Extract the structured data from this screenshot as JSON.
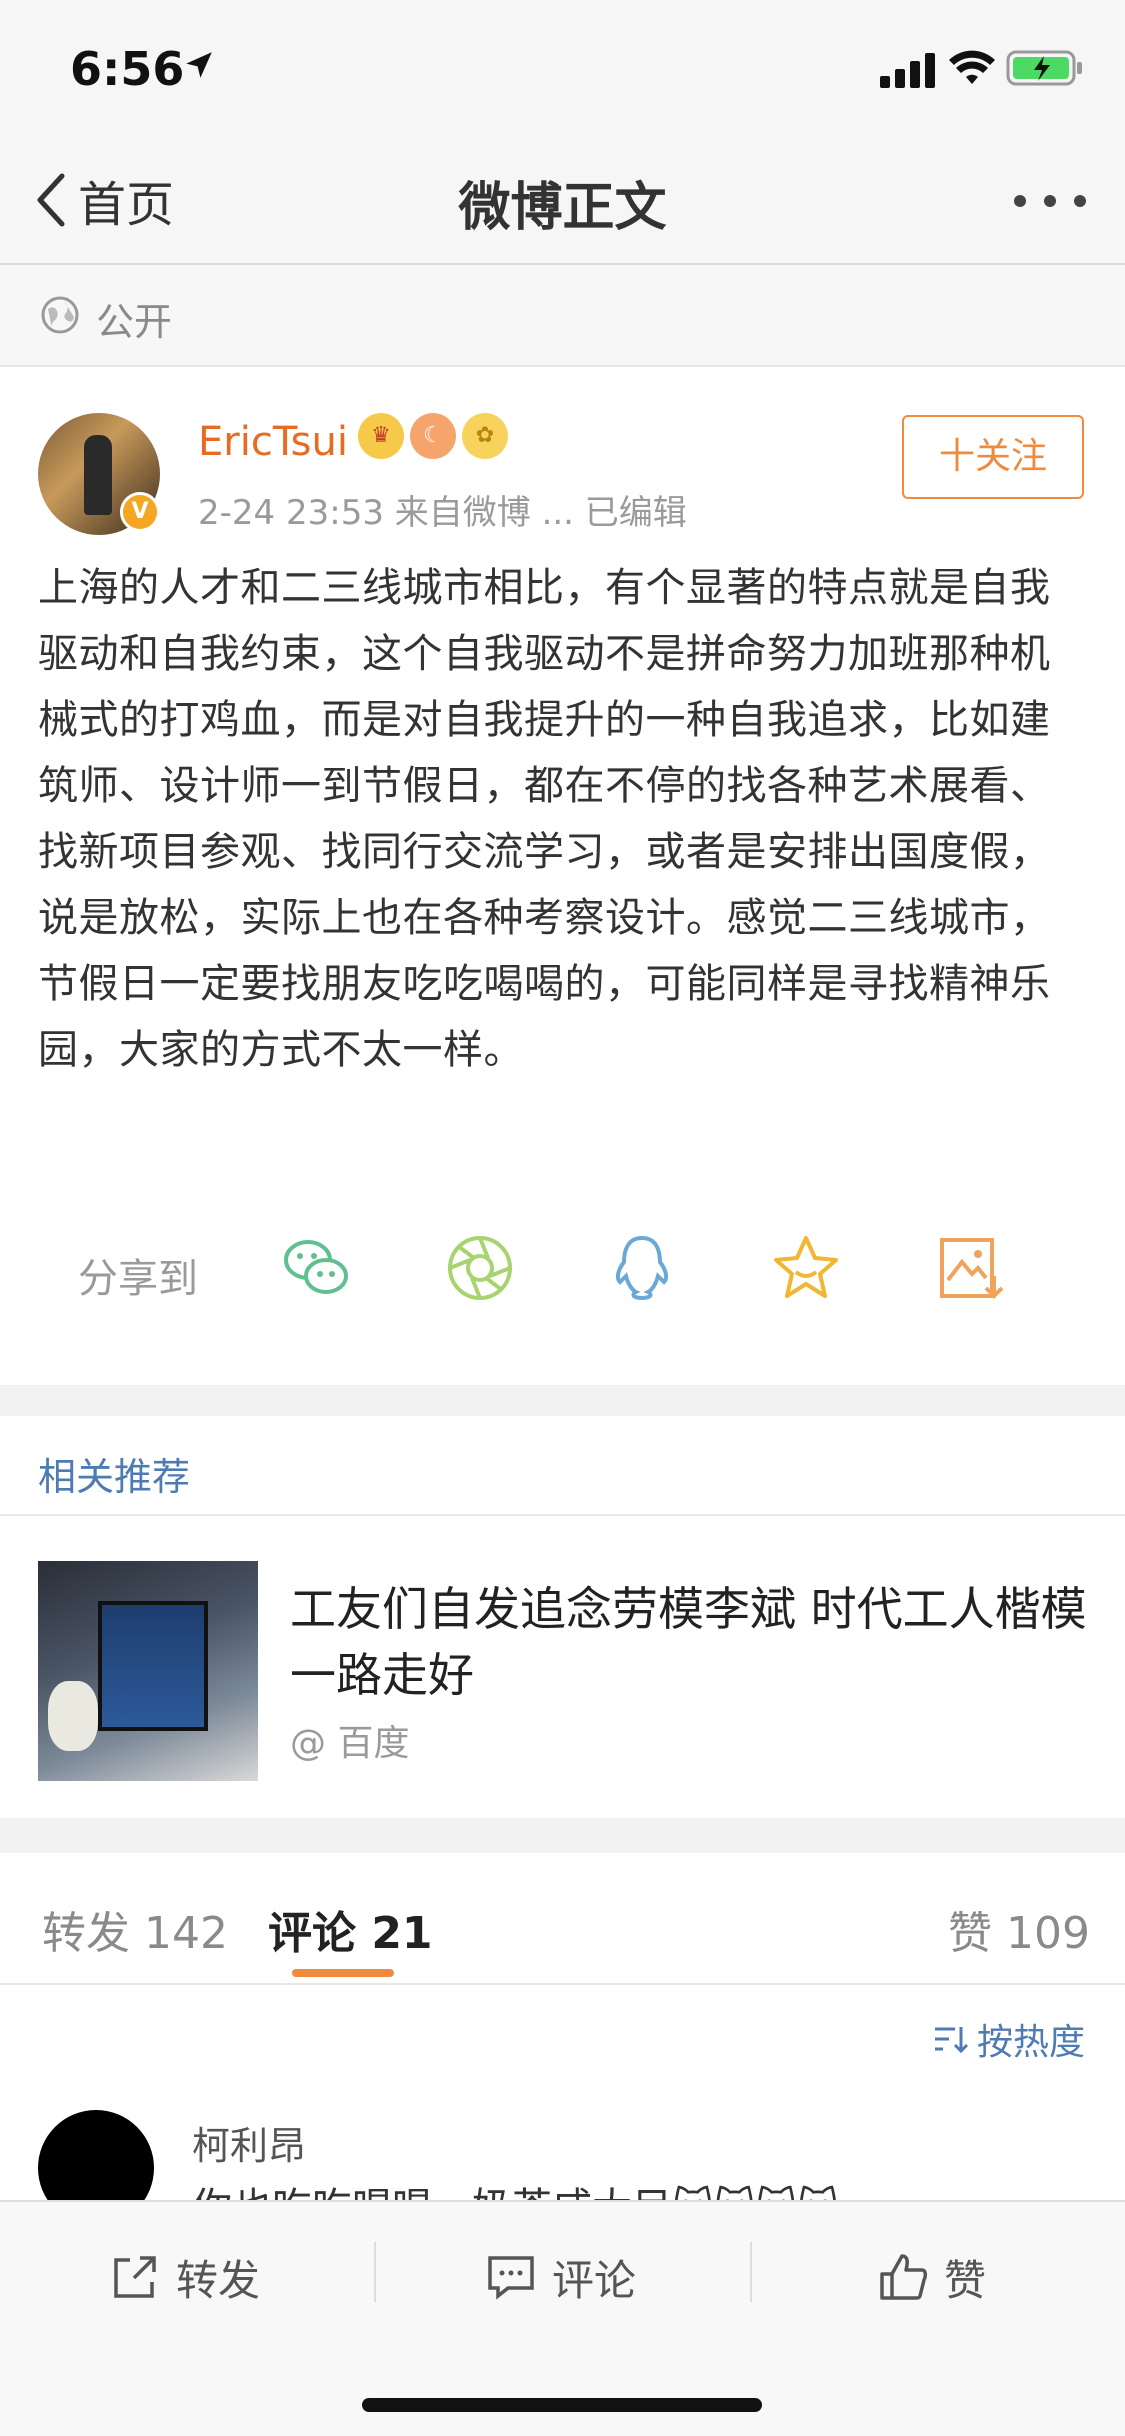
{
  "status_bar": {
    "time": "6:56"
  },
  "nav": {
    "back_label": "首页",
    "title": "微博正文"
  },
  "visibility": {
    "label": "公开"
  },
  "post": {
    "author": "EricTsui",
    "meta": "2-24 23:53  来自微博 ...  已编辑",
    "follow_label": "十关注",
    "verify_mark": "V",
    "text": "上海的人才和二三线城市相比，有个显著的特点就是自我驱动和自我约束，这个自我驱动不是拼命努力加班那种机械式的打鸡血，而是对自我提升的一种自我追求，比如建筑师、设计师一到节假日，都在不停的找各种艺术展看、找新项目参观、找同行交流学习，或者是安排出国度假，说是放松，实际上也在各种考察设计。感觉二三线城市，节假日一定要找朋友吃吃喝喝的，可能同样是寻找精神乐园，大家的方式不太一样。",
    "share_label": "分享到",
    "share_icons": [
      "wechat-icon",
      "moments-icon",
      "qq-icon",
      "favorite-icon",
      "save-image-icon"
    ]
  },
  "related": {
    "title": "相关推荐",
    "headline": "工友们自发追念劳模李斌 时代工人楷模一路走好",
    "source": "@ 百度"
  },
  "tabs": {
    "repost": "转发 142",
    "comment": "评论 21",
    "like": "赞 109"
  },
  "comments": {
    "sort_label": "按热度",
    "first": {
      "name": "柯利昂",
      "text": "你也吃吃喝喝，奶茶咸大目🐱🐱🐱🐱"
    }
  },
  "toolbar": {
    "repost_label": "转发",
    "comment_label": "评论",
    "like_label": "赞"
  },
  "colors": {
    "accent": "#f08a3c",
    "username": "#e86b24",
    "link_blue": "#4f7bb3"
  }
}
